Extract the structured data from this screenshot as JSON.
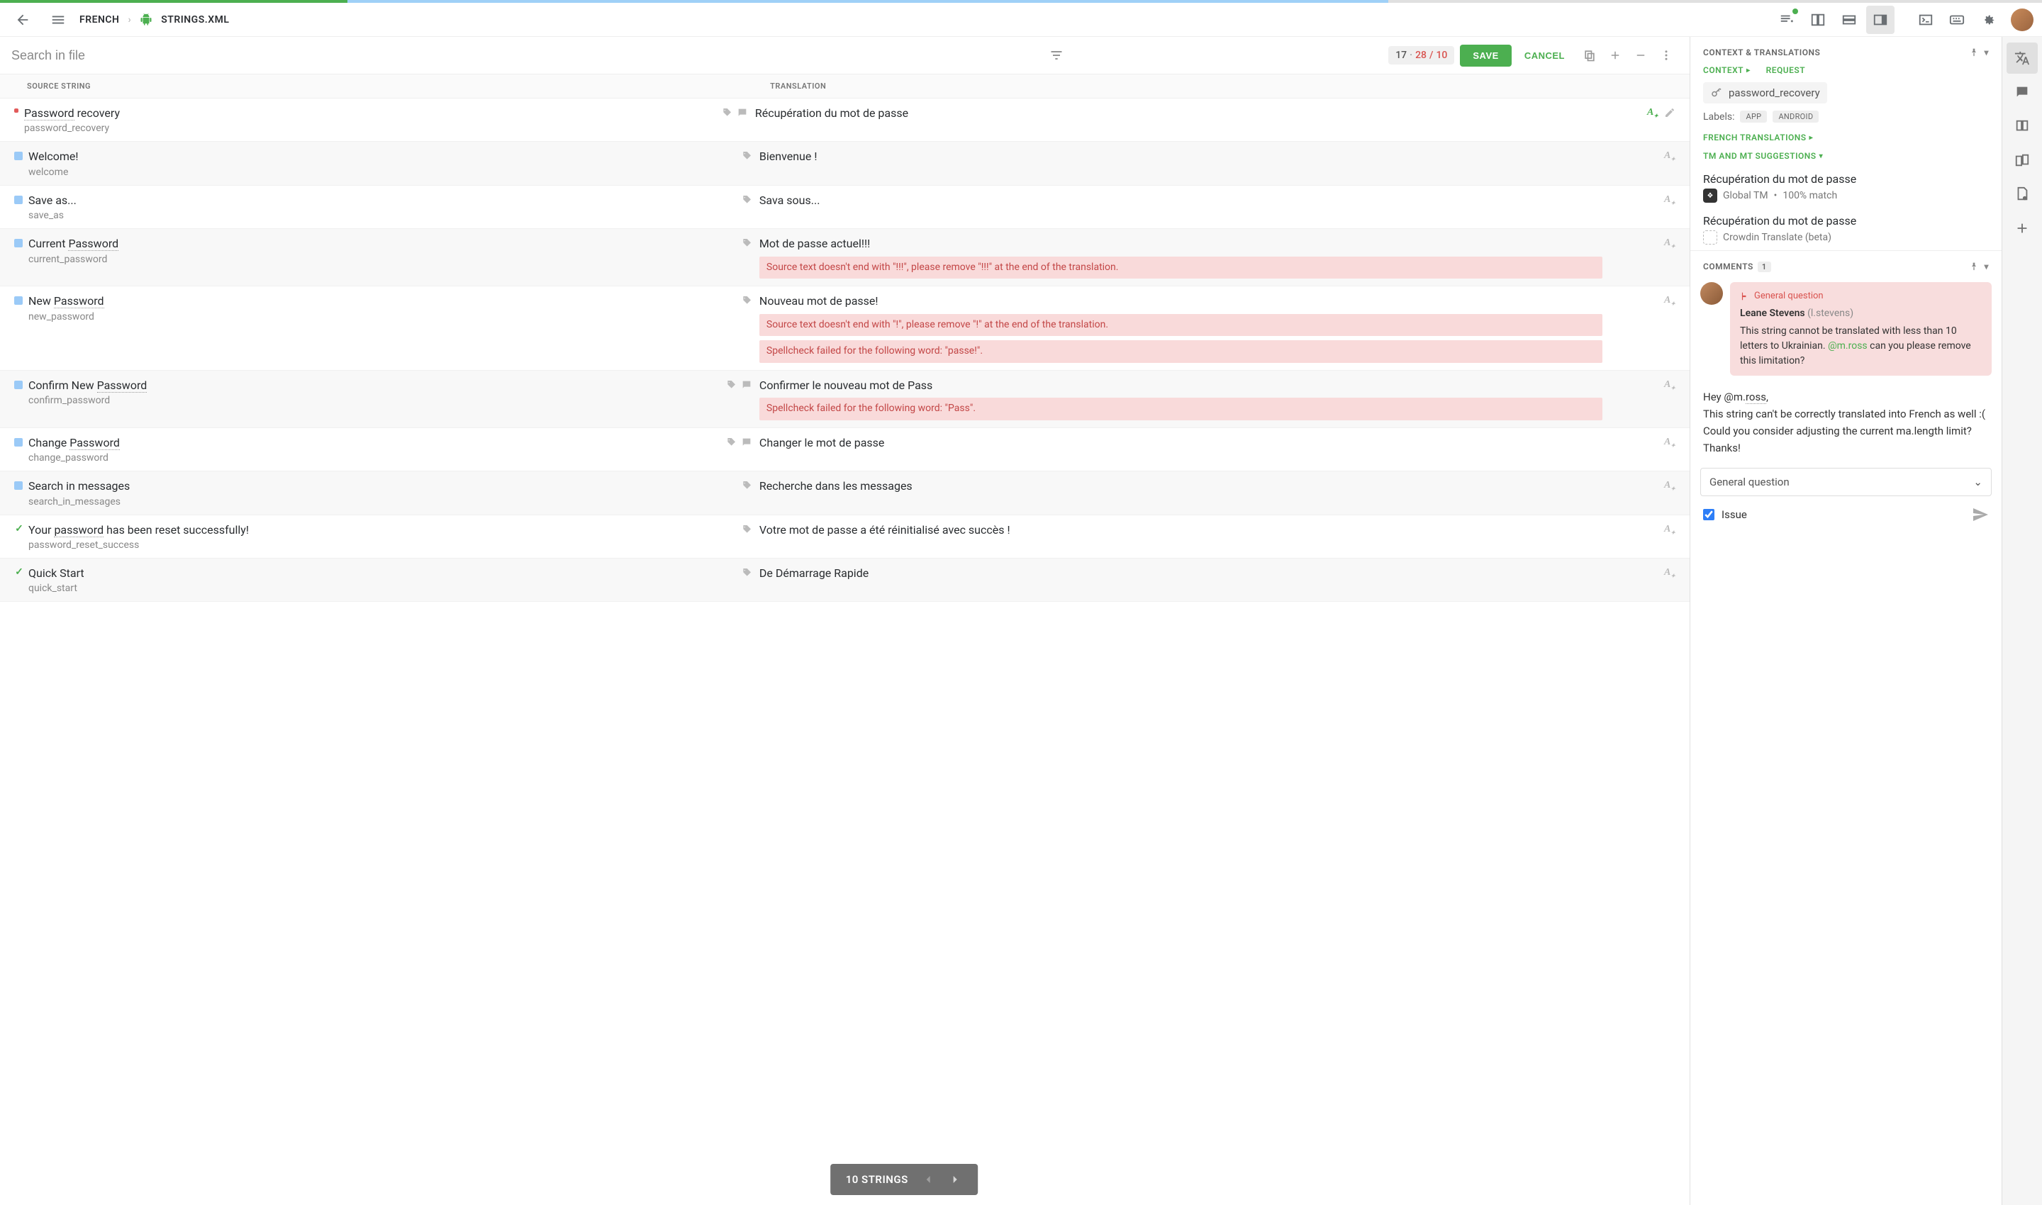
{
  "breadcrumb": {
    "lang": "FRENCH",
    "file": "STRINGS.XML"
  },
  "search": {
    "placeholder": "Search in file"
  },
  "counter": {
    "total": "17",
    "current": "28",
    "of": "10"
  },
  "actions": {
    "save": "SAVE",
    "cancel": "CANCEL"
  },
  "headers": {
    "source": "SOURCE STRING",
    "translation": "TRANSLATION"
  },
  "rows": [
    {
      "status": "red",
      "src": "Password recovery",
      "key": "password_recovery",
      "tr": "Récupération du mot de passe",
      "srcIcons": [
        "tag",
        "comment"
      ],
      "trIcons": [
        "auto-green",
        "edit"
      ],
      "errors": []
    },
    {
      "status": "blue",
      "src": "Welcome!",
      "key": "welcome",
      "tr": "Bienvenue !",
      "srcIcons": [
        "tag"
      ],
      "trIcons": [
        "auto"
      ],
      "errors": []
    },
    {
      "status": "blue",
      "src": "Save as...",
      "key": "save_as",
      "tr": "Sava sous...",
      "srcIcons": [
        "tag"
      ],
      "trIcons": [
        "auto"
      ],
      "errors": []
    },
    {
      "status": "blue",
      "src": "Current Password",
      "key": "current_password",
      "tr": "Mot de passe actuel!!!",
      "srcIcons": [
        "tag"
      ],
      "trIcons": [
        "auto"
      ],
      "errors": [
        "Source text doesn't end with \"!!!\", please remove \"!!!\" at the end of the translation."
      ]
    },
    {
      "status": "blue",
      "src": "New Password",
      "key": "new_password",
      "tr": "Nouveau mot de passe!",
      "srcIcons": [
        "tag"
      ],
      "trIcons": [
        "auto"
      ],
      "errors": [
        "Source text doesn't end with \"!\", please remove \"!\" at the end of the translation.",
        "Spellcheck failed for the following word: \"passe!\"."
      ]
    },
    {
      "status": "blue",
      "src": "Confirm New Password",
      "key": "confirm_password",
      "tr": "Confirmer le nouveau mot de Pass",
      "srcIcons": [
        "tag",
        "comment"
      ],
      "trIcons": [
        "auto"
      ],
      "errors": [
        "Spellcheck failed for the following word: \"Pass\"."
      ]
    },
    {
      "status": "blue",
      "src": "Change Password",
      "key": "change_password",
      "tr": "Changer le mot de passe",
      "srcIcons": [
        "tag",
        "comment"
      ],
      "trIcons": [
        "auto"
      ],
      "errors": []
    },
    {
      "status": "blue",
      "src": "Search in messages",
      "key": "search_in_messages",
      "tr": "Recherche dans les messages",
      "srcIcons": [
        "tag"
      ],
      "trIcons": [
        "auto"
      ],
      "errors": []
    },
    {
      "status": "check",
      "src": "Your password has been reset successfully!",
      "key": "password_reset_success",
      "tr": "Votre mot de passe a été réinitialisé avec succès !",
      "srcIcons": [
        "tag"
      ],
      "trIcons": [
        "auto"
      ],
      "errors": []
    },
    {
      "status": "check",
      "src": "Quick Start",
      "key": "quick_start",
      "tr": "De Démarrage Rapide",
      "srcIcons": [
        "tag"
      ],
      "trIcons": [
        "auto"
      ],
      "errors": []
    }
  ],
  "pager": {
    "label": "10 STRINGS"
  },
  "context": {
    "title": "CONTEXT & TRANSLATIONS",
    "tabs": {
      "context": "CONTEXT",
      "request": "REQUEST"
    },
    "key": "password_recovery",
    "labelsLabel": "Labels:",
    "labels": [
      "APP",
      "ANDROID"
    ],
    "frenchSection": "FRENCH TRANSLATIONS",
    "suggSection": "TM AND MT SUGGESTIONS",
    "suggestions": [
      {
        "text": "Récupération du mot de passe",
        "source": "Global TM",
        "match": "100% match",
        "iconType": "tm"
      },
      {
        "text": "Récupération du mot de passe",
        "source": "Crowdin Translate (beta)",
        "match": "",
        "iconType": "mt"
      }
    ]
  },
  "comments": {
    "title": "COMMENTS",
    "count": "1",
    "item": {
      "type": "General question",
      "author": "Leane Stevens",
      "username": "(l.stevens)",
      "text1": "This string cannot be translated with less than 10 letters to Ukrainian. ",
      "mention": "@m.ross",
      "text2": " can you please remove this limitation?"
    },
    "reply": {
      "l1a": "Hey @m.",
      "l1b": "ross",
      "l1c": ",",
      "l2": "This string can't be correctly translated into French as well :(",
      "l3": "Could you consider adjusting the current ma.length limit?",
      "l4": "Thanks!"
    },
    "selectValue": "General question",
    "issueLabel": "Issue"
  }
}
